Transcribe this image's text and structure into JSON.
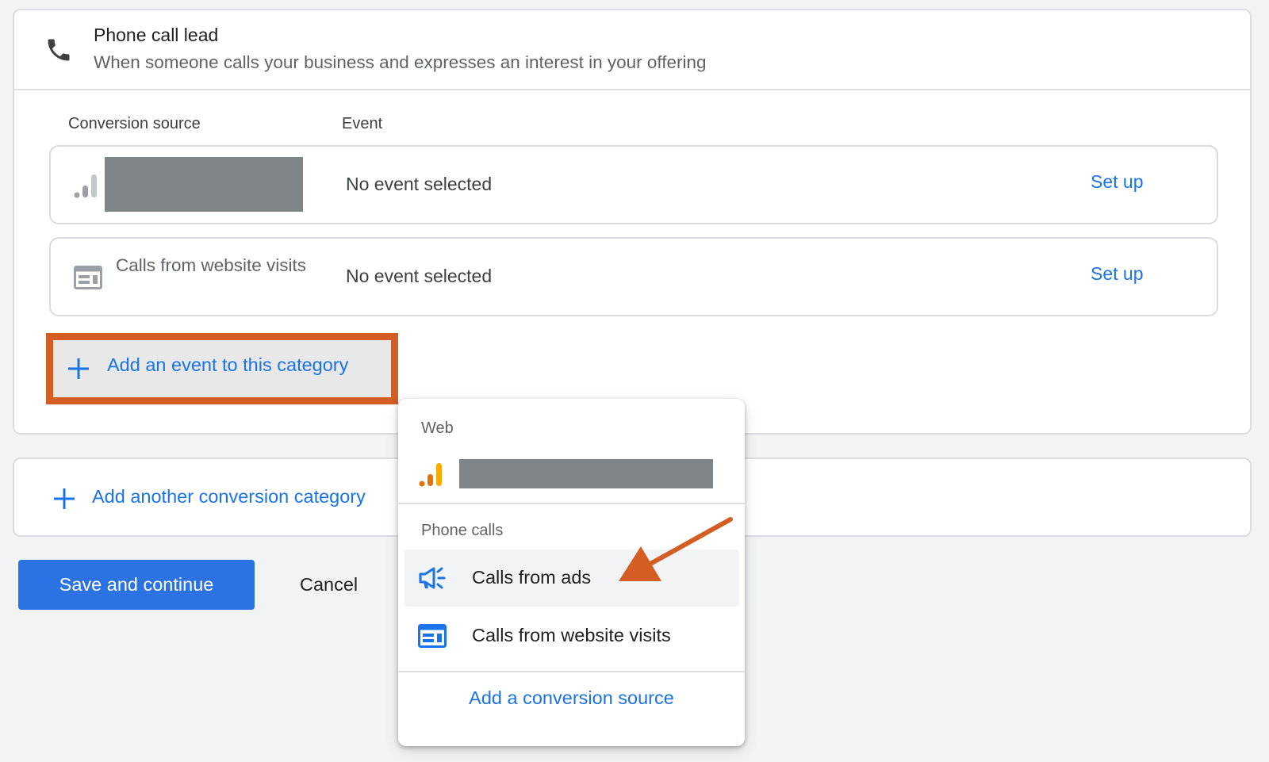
{
  "category": {
    "title": "Phone call lead",
    "description": "When someone calls your business and expresses an interest in your offering",
    "icon": "phone-icon"
  },
  "table": {
    "col_source": "Conversion source",
    "col_event": "Event",
    "rows": [
      {
        "source_icon": "analytics-bars-icon",
        "source_label": "",
        "event": "No event selected",
        "action": "Set up"
      },
      {
        "source_icon": "website-icon",
        "source_label": "Calls from website visits",
        "event": "No event selected",
        "action": "Set up"
      }
    ]
  },
  "add_event_label": "Add an event to this category",
  "add_category_label": "Add another conversion category",
  "save_label": "Save and continue",
  "cancel_label": "Cancel",
  "menu": {
    "section_web": "Web",
    "section_phone": "Phone calls",
    "items": [
      {
        "label": "Calls from ads",
        "icon": "megaphone-icon"
      },
      {
        "label": "Calls from website visits",
        "icon": "website-icon"
      }
    ],
    "add_source_label": "Add a conversion source"
  },
  "colors": {
    "accent": "#1a73e8",
    "primary_button": "#2b73e2",
    "highlight": "#d35d22",
    "redaction": "#7f8486",
    "analytics_orange": "#f9ab00"
  }
}
